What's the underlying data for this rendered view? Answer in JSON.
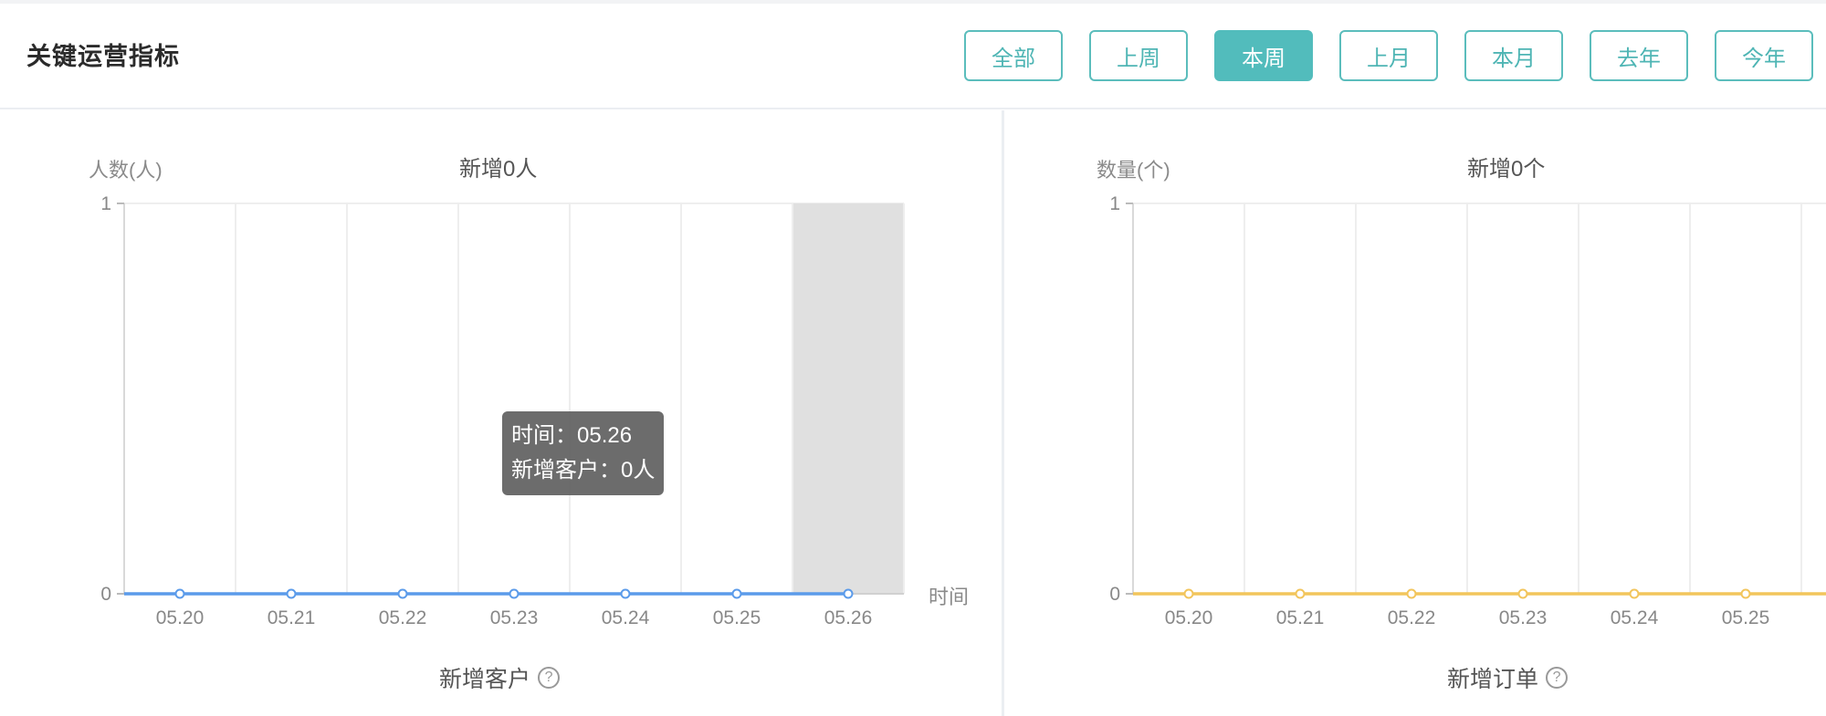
{
  "header": {
    "title": "关键运营指标",
    "buttons": [
      "全部",
      "上周",
      "本周",
      "上月",
      "本月",
      "去年",
      "今年"
    ],
    "active_button": "本周"
  },
  "left_chart": {
    "ylabel": "人数(人)",
    "title": "新增0人",
    "xlabel": "时间",
    "footer": "新增客户",
    "help_icon": "question-circle-icon",
    "tooltip": {
      "line1": "时间：05.26",
      "line2": "新增客户：0人"
    }
  },
  "right_chart": {
    "ylabel": "数量(个)",
    "title": "新增0个",
    "footer": "新增订单",
    "help_icon": "question-circle-icon"
  },
  "colors": {
    "accent": "#52bcbc",
    "line_blue": "#5b9bea",
    "line_yellow": "#f2c55c",
    "highlight": "#e0e0e0"
  },
  "chart_data": [
    {
      "type": "line",
      "categories": [
        "05.20",
        "05.21",
        "05.22",
        "05.23",
        "05.24",
        "05.25",
        "05.26"
      ],
      "series": [
        {
          "name": "新增客户",
          "values": [
            0,
            0,
            0,
            0,
            0,
            0,
            0
          ]
        }
      ],
      "title": "新增0人",
      "ylabel": "人数(人)",
      "xlabel": "时间",
      "ylim": [
        0,
        1
      ],
      "y_ticks": [
        "0",
        "1"
      ],
      "grid": "vertical",
      "highlighted_category": "05.26"
    },
    {
      "type": "line",
      "categories": [
        "05.20",
        "05.21",
        "05.22",
        "05.23",
        "05.24",
        "05.25"
      ],
      "series": [
        {
          "name": "新增订单",
          "values": [
            0,
            0,
            0,
            0,
            0,
            0
          ]
        }
      ],
      "title": "新增0个",
      "ylabel": "数量(个)",
      "ylim": [
        0,
        1
      ],
      "y_ticks": [
        "0",
        "1"
      ],
      "grid": "vertical"
    }
  ]
}
